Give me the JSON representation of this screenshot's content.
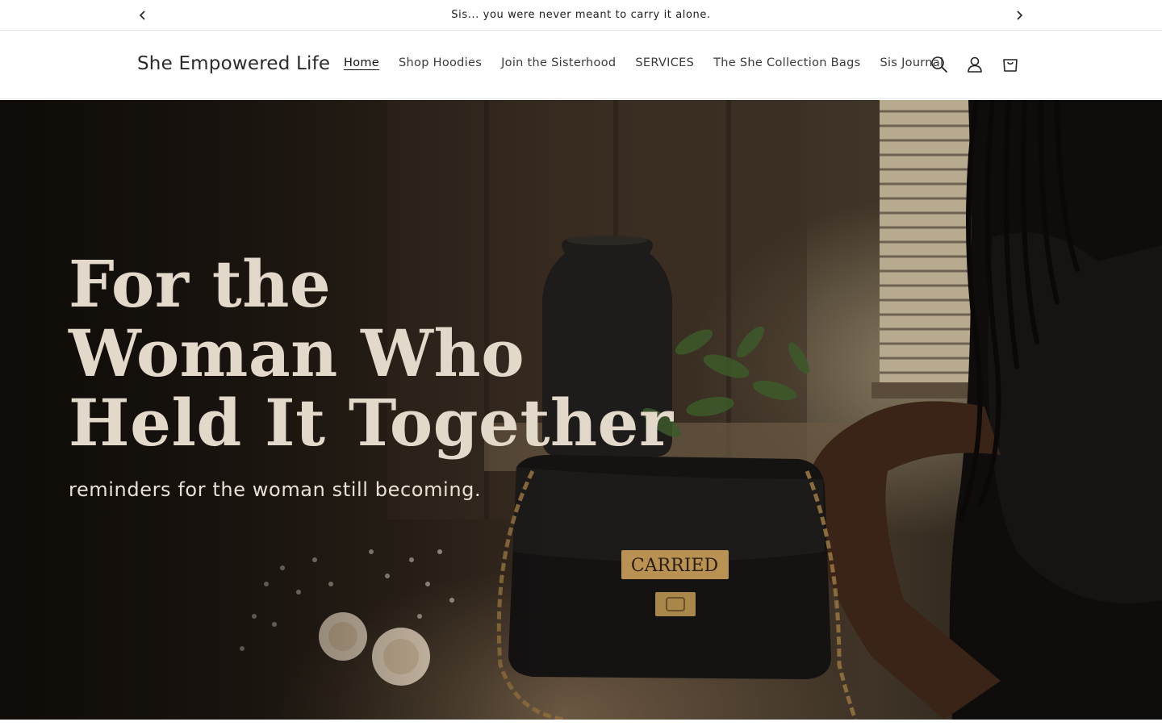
{
  "announcement": {
    "message": "Sis... you were never meant to carry it alone.",
    "prev_icon": "chevron-left-icon",
    "next_icon": "chevron-right-icon"
  },
  "header": {
    "logo": "She Empowered Life",
    "nav": [
      {
        "label": "Home",
        "active": true
      },
      {
        "label": "Shop Hoodies"
      },
      {
        "label": "Join the Sisterhood"
      },
      {
        "label": "SERVICES"
      },
      {
        "label": "The She Collection Bags"
      },
      {
        "label": "Sis Journal"
      }
    ],
    "icons": [
      "search-icon",
      "account-icon",
      "cart-icon"
    ]
  },
  "hero": {
    "title": "For the\nWoman Who\nHeld It Together",
    "subtitle": "reminders for the woman still becoming.",
    "bag_plate": "CARRIED"
  },
  "colors": {
    "text": "#121212",
    "hero_title": "#e3d9cb",
    "hero_subtitle": "#e9e1d6"
  }
}
